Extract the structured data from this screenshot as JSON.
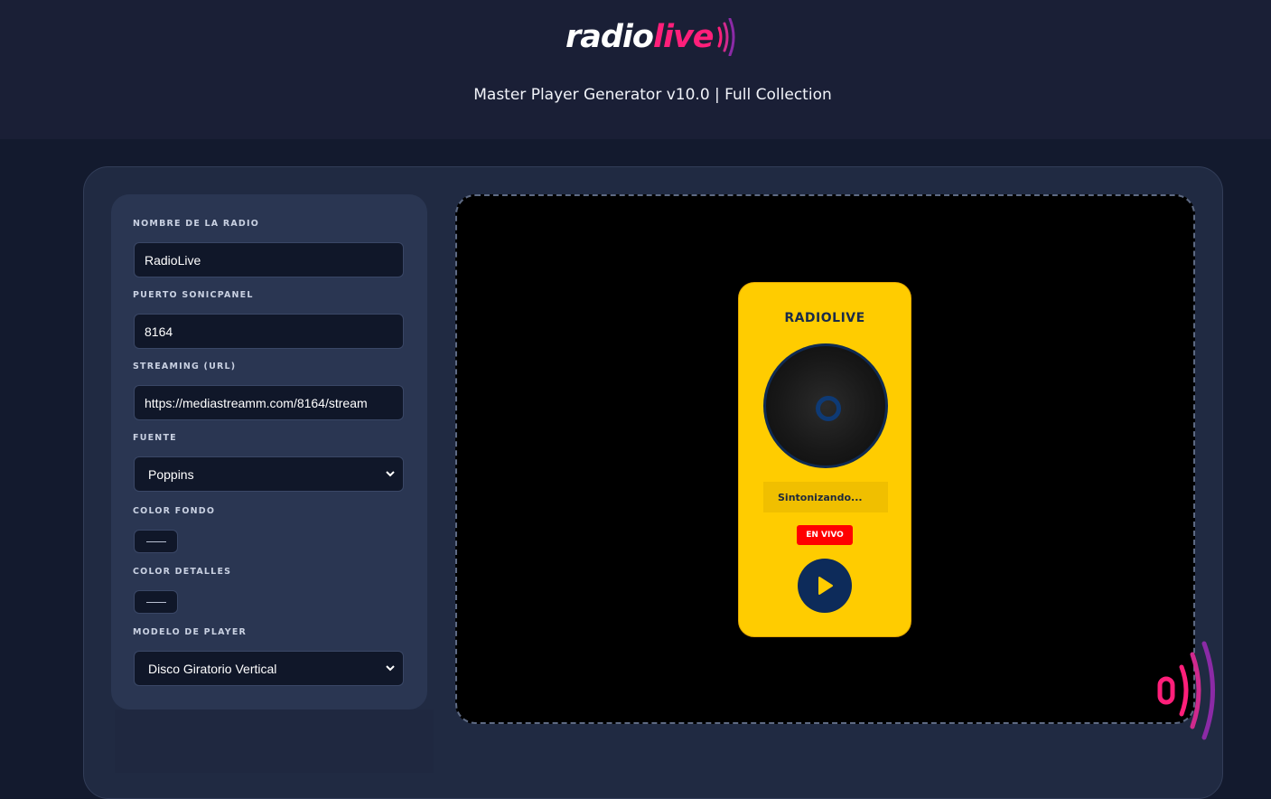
{
  "brand": {
    "logo_white": "radio",
    "logo_pink": "live",
    "subtitle": "Master Player Generator v10.0 | Full Collection"
  },
  "form": {
    "radio_name_label": "NOMBRE DE LA RADIO",
    "radio_name_value": "RadioLive",
    "port_label": "PUERTO SONICPANEL",
    "port_value": "8164",
    "stream_label": "STREAMING (URL)",
    "stream_value": "https://mediastreamm.com/8164/stream",
    "font_label": "FUENTE",
    "font_value": "Poppins",
    "bg_color_label": "COLOR FONDO",
    "detail_color_label": "COLOR DETALLES",
    "model_label": "MODELO DE PLAYER",
    "model_value": "Disco Giratorio Vertical"
  },
  "player": {
    "title": "RADIOLIVE",
    "status": "Sintonizando...",
    "badge": "EN VIVO"
  },
  "colors": {
    "accent_pink": "#ff1f7a",
    "player_bg": "#ffcc00",
    "player_details": "#0d2b5a",
    "live_badge": "#ff0000"
  }
}
